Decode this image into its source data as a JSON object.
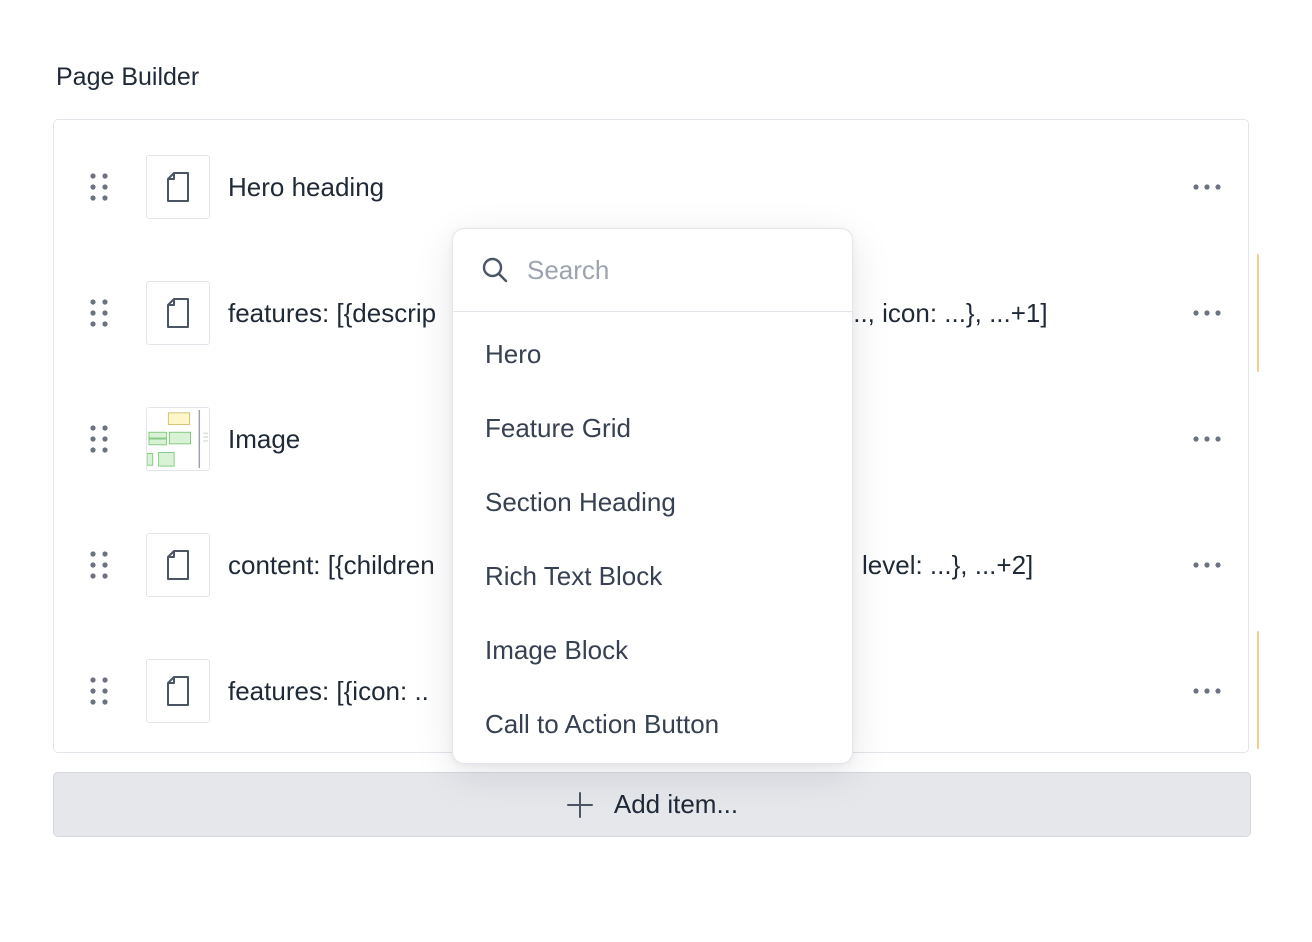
{
  "field": {
    "title": "Page Builder"
  },
  "rows": [
    {
      "label": "Hero heading",
      "thumb": "document-icon"
    },
    {
      "label": "features: [{descrip",
      "label_tail": "..., icon: ...}, ...+1]",
      "thumb": "document-icon"
    },
    {
      "label": "Image",
      "thumb": "image-thumbnail"
    },
    {
      "label": "content: [{children",
      "label_tail": "level: ...}, ...+2]",
      "thumb": "document-icon"
    },
    {
      "label": "features: [{icon: ..",
      "thumb": "document-icon"
    }
  ],
  "row_actions_icon": "more-horizontal-icon",
  "drag_icon": "drag-handle-icon",
  "add_button": {
    "label": "Add item...",
    "icon": "plus-icon"
  },
  "popover": {
    "search": {
      "placeholder": "Search",
      "value": ""
    },
    "items": [
      "Hero",
      "Feature Grid",
      "Section Heading",
      "Rich Text Block",
      "Image Block",
      "Call to Action Button"
    ]
  },
  "colors": {
    "text": "#1f2937",
    "muted": "#9ca3af",
    "border": "#e3e5ea",
    "button_bg": "#e5e7eb",
    "accent": "#f2cf8d",
    "icon": "#6b7280"
  }
}
